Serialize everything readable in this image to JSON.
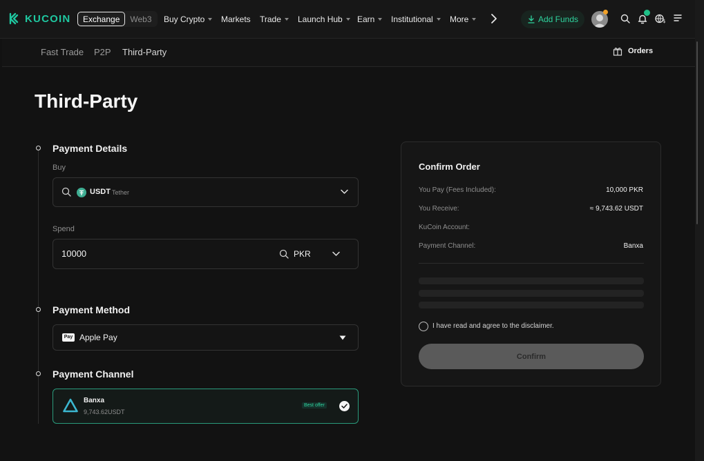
{
  "brand": {
    "name": "KUCOIN",
    "color": "#1fc7a0"
  },
  "header": {
    "mode_active": "Exchange",
    "mode_other": "Web3",
    "nav": [
      {
        "label": "Buy Crypto",
        "caret": true
      },
      {
        "label": "Markets",
        "caret": false
      },
      {
        "label": "Trade",
        "caret": true
      },
      {
        "label": "Launch Hub",
        "caret": true
      },
      {
        "label": "Earn",
        "caret": true
      },
      {
        "label": "Institutional",
        "caret": true
      },
      {
        "label": "More",
        "caret": true
      }
    ],
    "add_funds": "Add Funds",
    "icons": [
      "chevron-right-icon",
      "download-icon",
      "search-icon",
      "bell-icon",
      "globe-currency-icon",
      "menu-icon"
    ]
  },
  "subnav": {
    "items": [
      "Fast Trade",
      "P2P",
      "Third-Party"
    ],
    "active": "Third-Party",
    "orders": "Orders"
  },
  "page": {
    "title": "Third-Party"
  },
  "payment_details": {
    "title": "Payment Details",
    "buy_label": "Buy",
    "buy_symbol": "USDT",
    "buy_name": "Tether",
    "spend_label": "Spend",
    "spend_value": "10000",
    "spend_currency": "PKR"
  },
  "payment_method": {
    "title": "Payment Method",
    "icon_text": "Pay",
    "value": "Apple Pay"
  },
  "payment_channel": {
    "title": "Payment Channel",
    "name": "Banxa",
    "amount": "9,743.62USDT",
    "badge": "Best offer",
    "selected": true
  },
  "confirm_order": {
    "title": "Confirm Order",
    "rows": [
      {
        "label": "You Pay (Fees Included):",
        "value": "10,000 PKR"
      },
      {
        "label": "You Receive:",
        "value": "≈ 9,743.62 USDT"
      },
      {
        "label": "KuCoin Account:",
        "value": ""
      },
      {
        "label": "Payment Channel:",
        "value": "Banxa"
      }
    ],
    "agree_text": "I have read and agree to the disclaimer.",
    "button": "Confirm"
  },
  "colors": {
    "accent": "#2fd39e",
    "background": "#121212",
    "panel": "#161616",
    "selected_border": "#2a9b7c"
  }
}
